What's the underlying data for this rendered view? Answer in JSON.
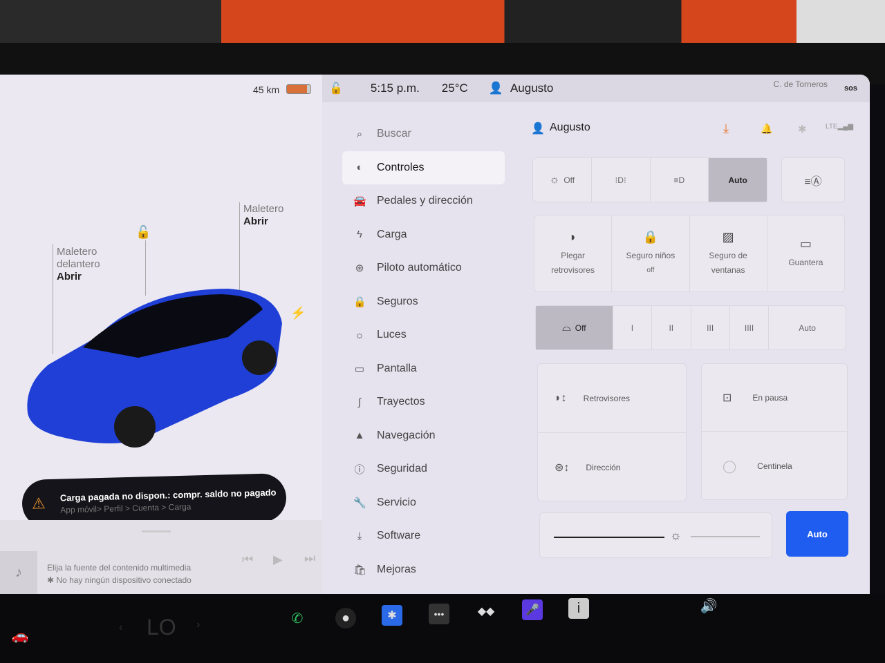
{
  "left": {
    "range": "45 km",
    "frunk_label": "Maletero delantero",
    "frunk_action": "Abrir",
    "trunk_label": "Maletero",
    "trunk_action": "Abrir",
    "alert": {
      "title": "Carga pagada no dispon.: compr. saldo no pagado",
      "subtitle": "App móvil> Perfil > Cuenta > Carga"
    },
    "media": {
      "line1": "Elija la fuente del contenido multimedia",
      "line2": "No hay ningún dispositivo conectado"
    }
  },
  "topbar": {
    "time": "5:15 p.m.",
    "temp": "25°C",
    "user": "Augusto",
    "location": "C. de Torneros",
    "sos": "sos"
  },
  "menu": {
    "search": "Buscar",
    "items": [
      {
        "label": "Controles",
        "icon": "toggle-icon",
        "selected": true
      },
      {
        "label": "Pedales y dirección",
        "icon": "car-icon"
      },
      {
        "label": "Carga",
        "icon": "bolt-icon"
      },
      {
        "label": "Piloto automático",
        "icon": "steering-wheel-icon"
      },
      {
        "label": "Seguros",
        "icon": "lock-icon"
      },
      {
        "label": "Luces",
        "icon": "sun-icon"
      },
      {
        "label": "Pantalla",
        "icon": "display-icon"
      },
      {
        "label": "Trayectos",
        "icon": "trips-icon"
      },
      {
        "label": "Navegación",
        "icon": "navigation-icon"
      },
      {
        "label": "Seguridad",
        "icon": "alert-circle-icon"
      },
      {
        "label": "Servicio",
        "icon": "wrench-icon"
      },
      {
        "label": "Software",
        "icon": "download-icon"
      },
      {
        "label": "Mejoras",
        "icon": "bag-icon"
      }
    ]
  },
  "controls": {
    "user": "Augusto",
    "accent": "#e8742a",
    "auto_blue": "#1f5cf0",
    "lights": {
      "off": "Off",
      "auto": "Auto",
      "selected": "Auto"
    },
    "tiles": [
      {
        "line1": "Plegar",
        "line2": "retrovisores"
      },
      {
        "line1": "Seguro niños",
        "line2": "off"
      },
      {
        "line1": "Seguro de",
        "line2": "ventanas"
      },
      {
        "line1": "Guantera",
        "line2": ""
      }
    ],
    "wipers": {
      "options": [
        "Off",
        "I",
        "II",
        "III",
        "IIII",
        "Auto"
      ],
      "selected": "Off"
    },
    "mirrors": "Retrovisores",
    "steering": "Dirección",
    "dashcam": "En pausa",
    "sentry": "Centinela",
    "brightness_auto": "Auto",
    "brightness": 0.6
  },
  "dock": {
    "climate": "LO"
  }
}
